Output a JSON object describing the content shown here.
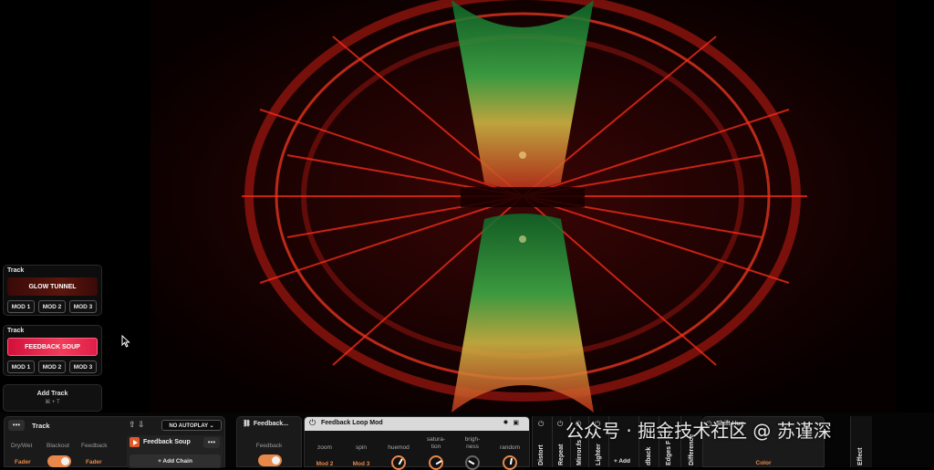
{
  "tracks": [
    {
      "label": "Track",
      "name": "GLOW TUNNEL",
      "mods": [
        "MOD 1",
        "MOD 2",
        "MOD 3"
      ]
    },
    {
      "label": "Track",
      "name": "FEEDBACK SOUP",
      "mods": [
        "MOD 1",
        "MOD 2",
        "MOD 3"
      ]
    }
  ],
  "add_track": {
    "label": "Add Track",
    "shortcut": "⌘ + T"
  },
  "track_panel": {
    "menu": "•••",
    "title": "Track",
    "arrows": "⇧ ⇩",
    "autoplay": "NO AUTOPLAY ⌄",
    "columns": [
      "Dry/Wet",
      "Blackout",
      "Feedback"
    ],
    "fader_labels": [
      "Fader",
      "Fader"
    ],
    "chain": {
      "name": "Feedback Soup",
      "menu": "•••",
      "add_label": "+ Add Chain"
    }
  },
  "feedback_panel": {
    "title": "Feedback...",
    "sub": "Feedback"
  },
  "loop_mod": {
    "title": "Feedback Loop Mod",
    "params": [
      {
        "label": "zoom",
        "value": "Mod 2"
      },
      {
        "label": "spin",
        "value": "Mod 3"
      },
      {
        "label": "huemod",
        "value": ""
      },
      {
        "label": "satura-\ntion",
        "value": ""
      },
      {
        "label": "brigh-\nness",
        "value": ""
      },
      {
        "label": "random",
        "value": ""
      }
    ]
  },
  "strips": [
    {
      "label": "Distort"
    },
    {
      "label": "Repeat"
    },
    {
      "label": "Mirror.fs"
    },
    {
      "label": "Lighter"
    },
    {
      "label": "dback"
    },
    {
      "label": "Edges F"
    },
    {
      "label": "Difference"
    }
  ],
  "add_label": "+ Add",
  "color_panel": {
    "title": "Shift Hue",
    "bottom": "Color"
  },
  "right_strip": {
    "label": "Effect"
  },
  "watermark": "公众号 · 掘金技术社区 @ 苏谨深",
  "colors": {
    "accent": "#e8884a",
    "active_track": "#e01e48",
    "panel": "#1a1a1a"
  }
}
